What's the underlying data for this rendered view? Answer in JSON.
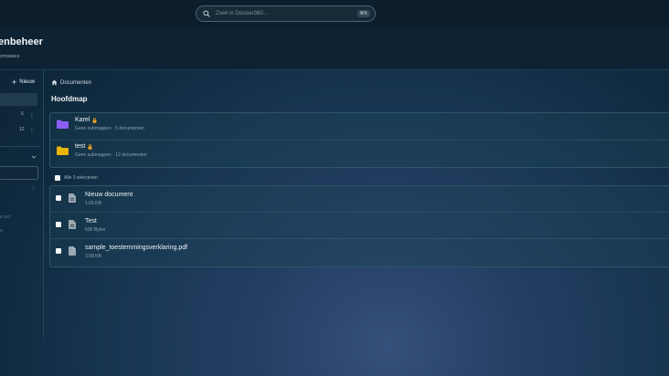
{
  "search": {
    "placeholder": "Zoek in Dossier360...",
    "shortcut": "⌘K"
  },
  "header": {
    "title": "enbeheer",
    "subtitle": "ermissies"
  },
  "sidebar": {
    "new_label": "Nieuw",
    "counts": [
      "5",
      "12"
    ],
    "faint_lines": [
      "ILDIG",
      "N"
    ]
  },
  "breadcrumb": {
    "label": "Documenten"
  },
  "main": {
    "heading": "Hoofdmap",
    "folders": [
      {
        "name": "Karel",
        "meta": "Geen submappen · 5 documenten",
        "color": "#8b5cf6"
      },
      {
        "name": "test",
        "meta": "Geen submappen · 12 documenten",
        "color": "#eab308"
      }
    ],
    "select_all_label": "Alle 3 selecteren",
    "files": [
      {
        "name": "Nieuw document",
        "size": "1.66 KB",
        "icon": "doc-icon"
      },
      {
        "name": "Test",
        "size": "606 Bytes",
        "icon": "doc-icon"
      },
      {
        "name": "sample_toestemmingsverklaring.pdf",
        "size": "3.58 KB",
        "icon": "pdf-icon"
      }
    ]
  },
  "colors": {
    "topbar": "#0c1e2c",
    "folder_purple": "#8b5cf6",
    "folder_yellow": "#eab308",
    "lock": "#f5a524"
  }
}
